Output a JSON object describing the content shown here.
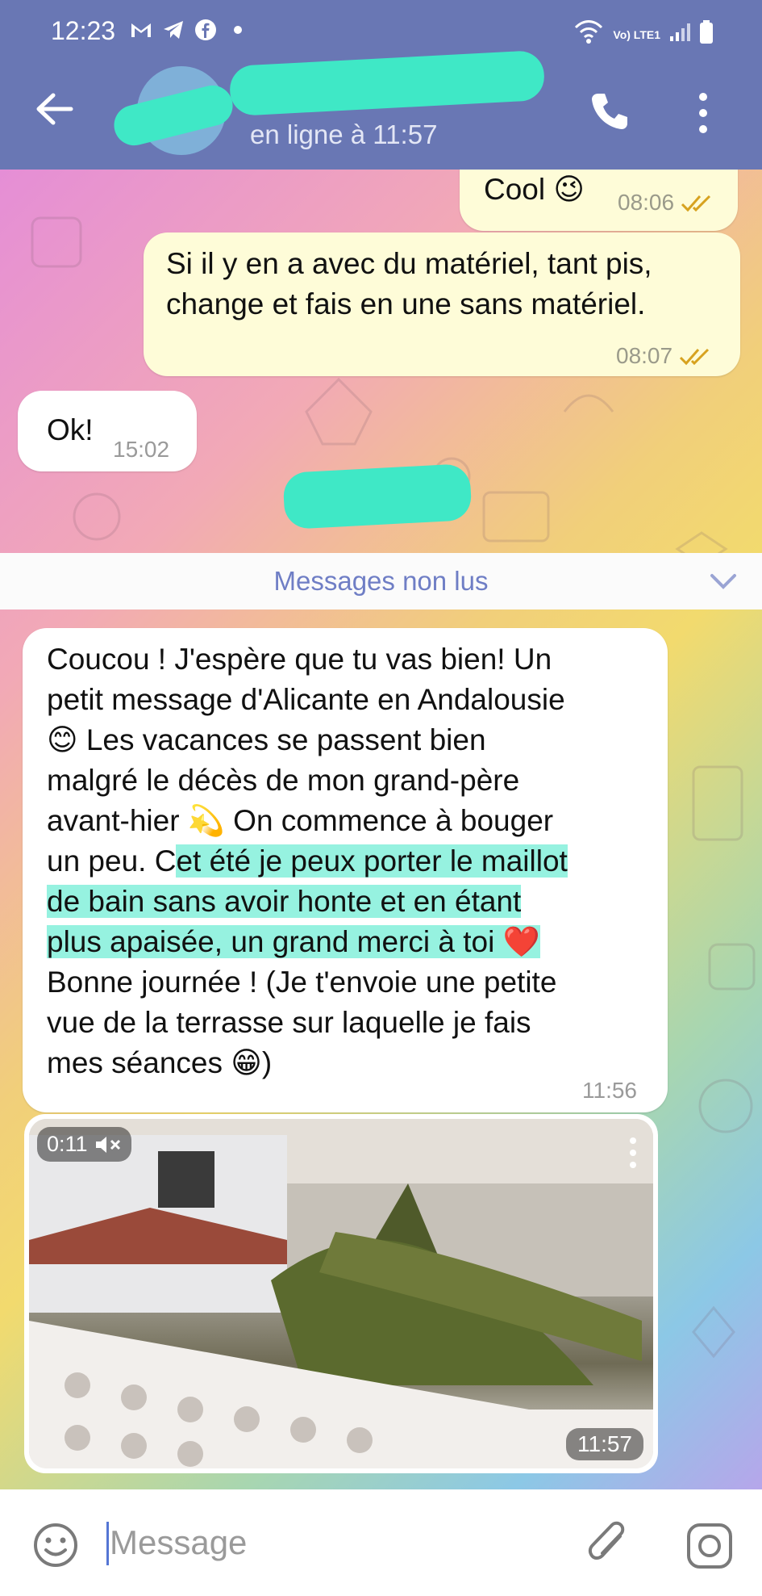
{
  "status_bar": {
    "time": "12:23",
    "left_icons": [
      "gmail-icon",
      "telegram-icon",
      "facebook-icon",
      "dot-icon"
    ],
    "network": "Vo) LTE1"
  },
  "header": {
    "contact_name": "",
    "contact_status": "en ligne à 11:57"
  },
  "messages": [
    {
      "text": "Cool 😉",
      "time": "08:06",
      "direction": "outgoing"
    },
    {
      "text_lines": [
        "Si il y en a avec du matériel, tant pis,",
        "change et fais en une sans matériel."
      ],
      "time": "08:07",
      "direction": "outgoing"
    },
    {
      "text": "Ok!",
      "time": "15:02",
      "direction": "incoming"
    }
  ],
  "unread": {
    "label": "Messages non lus"
  },
  "long_message": {
    "lines": [
      "Coucou ! J'espère que tu vas bien! Un",
      "petit message d'Alicante en Andalousie",
      "😊 Les vacances se passent bien",
      "malgré le décès de mon grand-père",
      "avant-hier 💫 On commence à bouger",
      "un peu. C",
      "et été je peux porter le maillot",
      "de bain sans avoir honte et en étant",
      "plus apaisée, un grand merci à toi ❤️",
      "Bonne journée ! (Je t'envoie une petite",
      "vue de la terrasse sur laquelle je fais",
      "mes séances 😁)"
    ],
    "time": "11:56"
  },
  "video_message": {
    "duration": "0:11",
    "time": "11:57"
  },
  "input": {
    "placeholder": "Message"
  },
  "colors": {
    "header": "#6977b4",
    "outgoing_bubble": "#fefcd8",
    "incoming_bubble": "#ffffff",
    "accent": "#6f7ec5",
    "highlight": "#3fe8c6"
  }
}
